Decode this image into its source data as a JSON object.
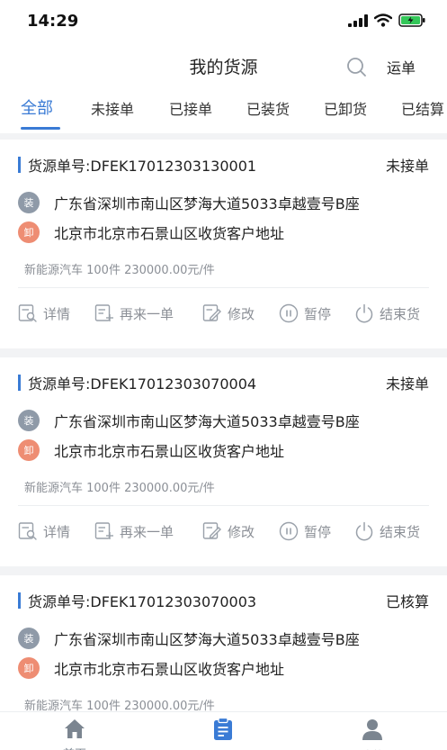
{
  "status_bar": {
    "time": "14:29"
  },
  "header": {
    "title": "我的货源",
    "waybill_label": "运单"
  },
  "tabs": [
    "全部",
    "未接单",
    "已接单",
    "已装货",
    "已卸货",
    "已结算"
  ],
  "labels": {
    "order_prefix": "货源单号:"
  },
  "badges": {
    "load": "装",
    "unload": "卸"
  },
  "actions": {
    "detail": "详情",
    "reorder": "再来一单",
    "edit": "修改",
    "pause": "暂停",
    "finish": "结束货"
  },
  "cards": [
    {
      "order_no": "DFEK17012303130001",
      "status": "未接单",
      "load_address": "广东省深圳市南山区梦海大道5033卓越壹号B座",
      "unload_address": "北京市北京市石景山区收货客户地址",
      "goods": "新能源汽车 100件 230000.00元/件"
    },
    {
      "order_no": "DFEK17012303070004",
      "status": "未接单",
      "load_address": "广东省深圳市南山区梦海大道5033卓越壹号B座",
      "unload_address": "北京市北京市石景山区收货客户地址",
      "goods": "新能源汽车 100件 230000.00元/件"
    },
    {
      "order_no": "DFEK17012303070003",
      "status": "已核算",
      "load_address": "广东省深圳市南山区梦海大道5033卓越壹号B座",
      "unload_address": "北京市北京市石景山区收货客户地址",
      "goods": "新能源汽车 100件 230000.00元/件"
    }
  ],
  "bottom_nav": [
    {
      "label": "首页",
      "icon": "home-icon"
    },
    {
      "label": "运单",
      "icon": "clipboard-icon"
    },
    {
      "label": "我的",
      "icon": "user-icon"
    }
  ],
  "colors": {
    "accent": "#3a7bd5",
    "load_badge": "#8f9aa8",
    "unload_badge": "#ee8d73"
  }
}
